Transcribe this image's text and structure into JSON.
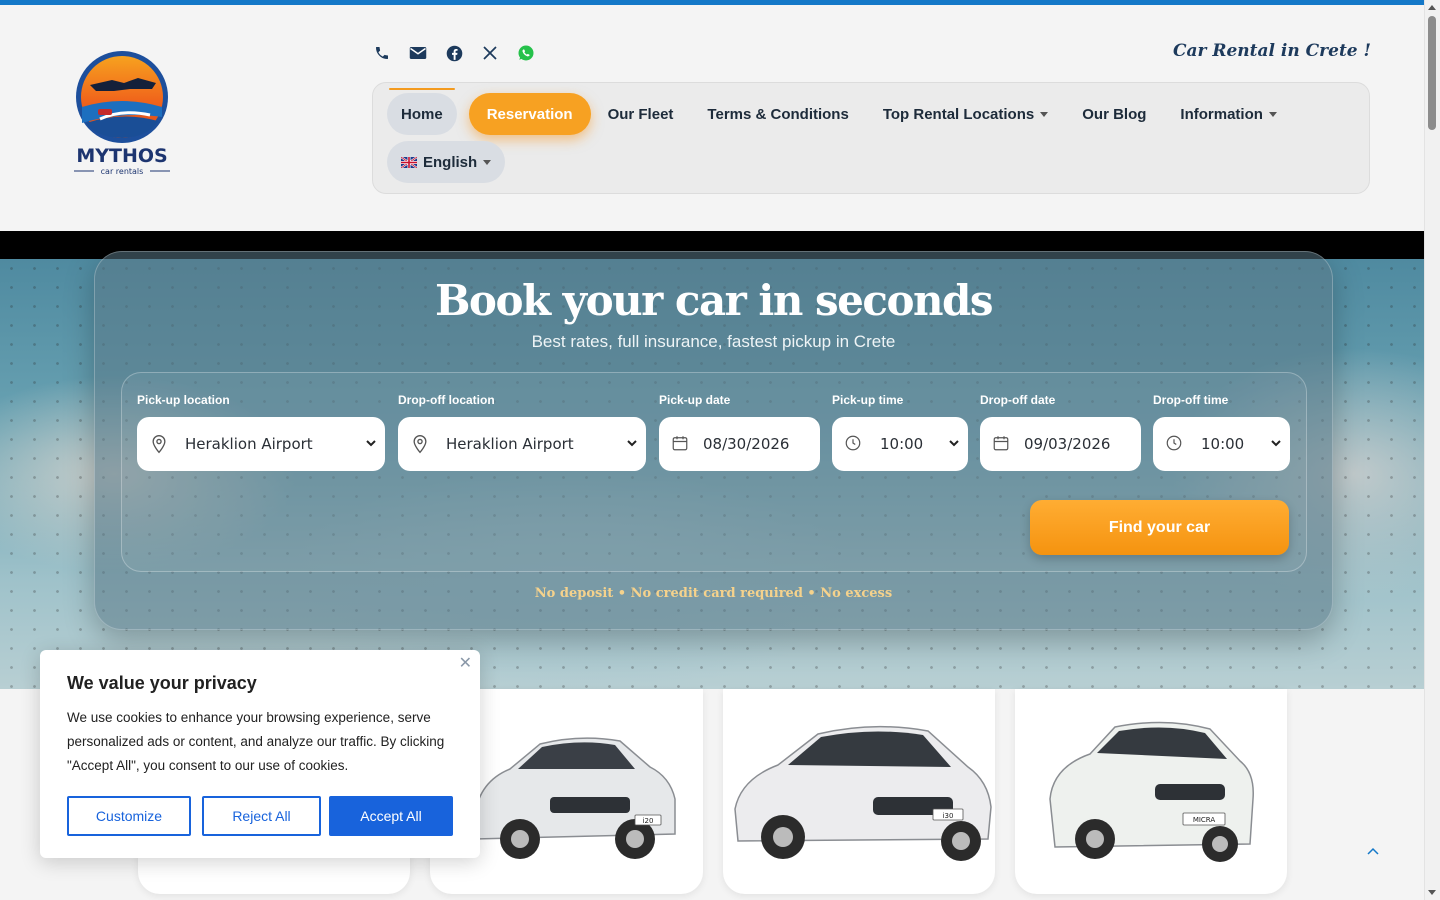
{
  "header": {
    "logo_name": "MYTHOS",
    "logo_sub": "car rentals",
    "tagline": "Car Rental in Crete !",
    "social_icons": [
      "phone-icon",
      "mail-icon",
      "facebook-icon",
      "x-icon",
      "whatsapp-icon"
    ]
  },
  "nav": {
    "items": [
      "Home",
      "Reservation",
      "Our Fleet",
      "Terms & Conditions",
      "Top Rental Locations",
      "Our Blog",
      "Information"
    ],
    "language": "English"
  },
  "hero": {
    "title": "Book your car in seconds",
    "subtitle": "Best rates, full insurance, fastest pickup in Crete",
    "fields": {
      "pickup_location": {
        "label": "Pick-up location",
        "value": "Heraklion Airport"
      },
      "dropoff_location": {
        "label": "Drop-off location",
        "value": "Heraklion Airport"
      },
      "pickup_date": {
        "label": "Pick-up date",
        "value": "08/30/2026"
      },
      "pickup_time": {
        "label": "Pick-up time",
        "value": "10:00"
      },
      "dropoff_date": {
        "label": "Drop-off date",
        "value": "09/03/2026"
      },
      "dropoff_time": {
        "label": "Drop-off time",
        "value": "10:00"
      }
    },
    "find_button": "Find your car",
    "note": "No deposit • No credit card required • No excess"
  },
  "cars": {
    "plates": [
      "i20",
      "i30",
      "MICRA"
    ]
  },
  "cookie": {
    "title": "We value your privacy",
    "text": "We use cookies to enhance your browsing experience, serve personalized ads or content, and analyze our traffic. By clicking \"Accept All\", you consent to our use of cookies.",
    "customize": "Customize",
    "reject": "Reject All",
    "accept": "Accept All",
    "close": "✕"
  },
  "colors": {
    "accent": "#f7a122",
    "brand_blue": "#1478c8",
    "cookie_blue": "#1863dc"
  }
}
